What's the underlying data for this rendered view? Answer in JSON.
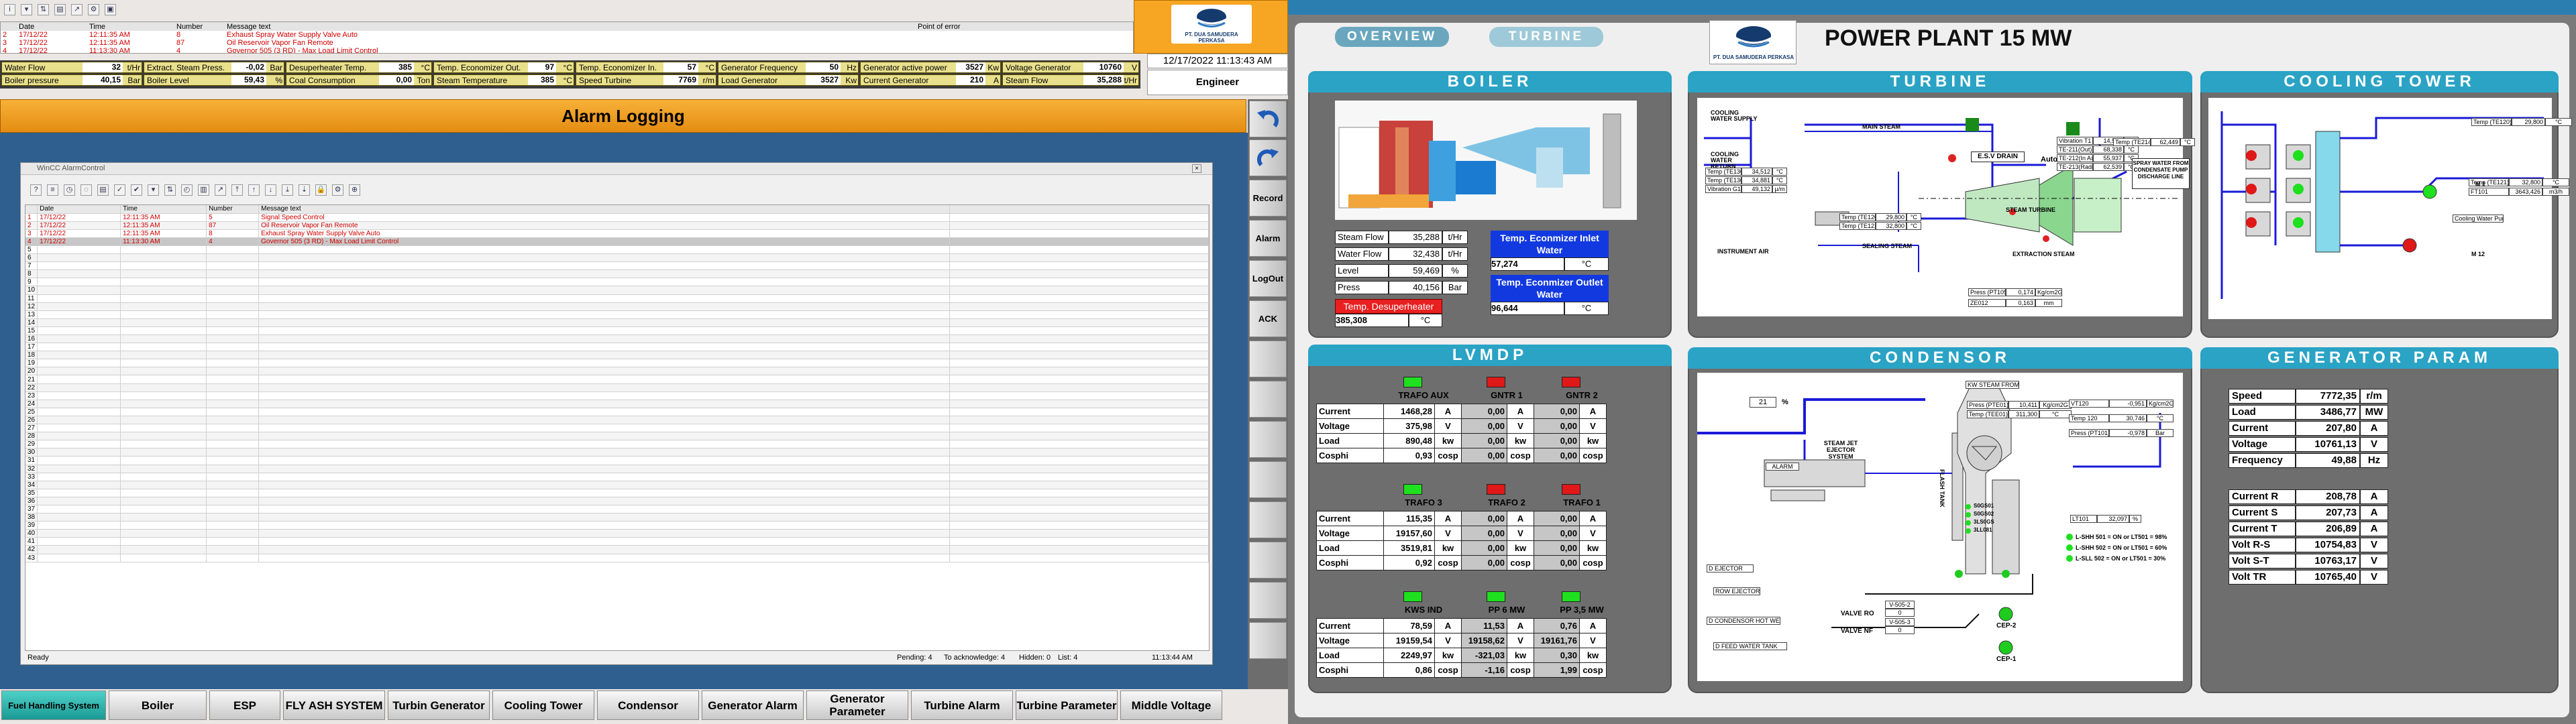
{
  "top_alarm": {
    "headers": [
      "Date",
      "Time",
      "Number",
      "Message text",
      "Point of error"
    ],
    "rows": [
      {
        "idx": "2",
        "date": "17/12/22",
        "time": "12:11:35 AM",
        "num": "8",
        "msg": "Exhaust Spray Water Supply Valve Auto"
      },
      {
        "idx": "3",
        "date": "17/12/22",
        "time": "12:11:35 AM",
        "num": "87",
        "msg": "Oil Reservoir Vapor Fan Remote"
      },
      {
        "idx": "4",
        "date": "17/12/22",
        "time": "11:13:30 AM",
        "num": "4",
        "msg": "Governor 505 (3 RD) - Max Load Limit Control"
      }
    ]
  },
  "toolbar_icons": [
    "info-icon",
    "filter-icon",
    "sort-icon",
    "print-icon",
    "export-icon",
    "settings-icon"
  ],
  "tags": [
    {
      "name": "Water Flow",
      "value": "32",
      "unit": "t/Hr"
    },
    {
      "name": "Boiler pressure",
      "value": "40,15",
      "unit": "Bar"
    },
    {
      "name": "Extract. Steam Press.",
      "value": "-0,02",
      "unit": "Bar"
    },
    {
      "name": "Boiler Level",
      "value": "59,43",
      "unit": "%"
    },
    {
      "name": "Desuperheater Temp.",
      "value": "385",
      "unit": "°C"
    },
    {
      "name": "Coal Consumption",
      "value": "0,00",
      "unit": "Ton"
    },
    {
      "name": "Temp. Economizer Out.",
      "value": "97",
      "unit": "°C"
    },
    {
      "name": "Steam Temperature",
      "value": "385",
      "unit": "°C"
    },
    {
      "name": "Temp. Economizer In.",
      "value": "57",
      "unit": "°C"
    },
    {
      "name": "Speed Turbine",
      "value": "7769",
      "unit": "r/m"
    },
    {
      "name": "Generator Frequency",
      "value": "50",
      "unit": "Hz"
    },
    {
      "name": "Load Generator",
      "value": "3527",
      "unit": "Kw"
    },
    {
      "name": "Generator active power",
      "value": "3527",
      "unit": "Kw"
    },
    {
      "name": "Current Generator",
      "value": "210",
      "unit": "A"
    },
    {
      "name": "Voltage Generator",
      "value": "10760",
      "unit": "V"
    },
    {
      "name": "Steam Flow",
      "value": "35,288",
      "unit": "t/Hr"
    }
  ],
  "company": "PT. DUA SAMUDERA PERKASA",
  "datetime": "12/17/2022 11:13:43 AM",
  "user": "Engineer",
  "page_title": "Alarm Logging",
  "alarm_window": {
    "title": "WinCC AlarmControl",
    "headers": [
      "Date",
      "Time",
      "Number",
      "Message text"
    ],
    "rows": [
      {
        "idx": "1",
        "date": "17/12/22",
        "time": "12:11:35 AM",
        "num": "5",
        "msg": "Signal Speed Control"
      },
      {
        "idx": "2",
        "date": "17/12/22",
        "time": "12:11:35 AM",
        "num": "87",
        "msg": "Oil Reservoir Vapor Fan Remote"
      },
      {
        "idx": "3",
        "date": "17/12/22",
        "time": "12:11:35 AM",
        "num": "8",
        "msg": "Exhaust Spray Water Supply Valve Auto"
      },
      {
        "idx": "4",
        "date": "17/12/22",
        "time": "11:13:30 AM",
        "num": "4",
        "msg": "Governor 505 (3 RD) - Max Load Limit Control"
      }
    ],
    "empty_rows": [
      "5",
      "6",
      "7",
      "8",
      "9",
      "10",
      "11",
      "12",
      "13",
      "14",
      "15",
      "16",
      "17",
      "18",
      "19",
      "20",
      "21",
      "22",
      "23",
      "24",
      "25",
      "26",
      "27",
      "28",
      "29",
      "30",
      "31",
      "32",
      "33",
      "34",
      "35",
      "36",
      "37",
      "38",
      "39",
      "40",
      "41",
      "42",
      "43"
    ],
    "status_ready": "Ready",
    "status_pending": "Pending: 4",
    "status_ack": "To acknowledge: 4",
    "status_hidden": "Hidden: 0",
    "status_list": "List: 4",
    "status_time": "11:13:44 AM"
  },
  "side_buttons": {
    "record": "Record",
    "alarm": "Alarm",
    "logout": "LogOut",
    "ack": "ACK"
  },
  "nav": [
    "Fuel Handling System",
    "Boiler",
    "ESP",
    "FLY ASH SYSTEM",
    "Turbin Generator",
    "Cooling Tower",
    "Condensor",
    "Generator Alarm",
    "Generator Parameter",
    "Turbine Alarm",
    "Turbine Parameter",
    "Middle Voltage"
  ],
  "plant": {
    "tabs": [
      "OVERVIEW",
      "TURBINE"
    ],
    "title": "POWER PLANT 15 MW",
    "logo_text": "PT. DUA SAMUDERA PERKASA",
    "boiler": {
      "title": "BOILER",
      "rows": [
        {
          "name": "Steam Flow",
          "value": "35,288",
          "unit": "t/Hr"
        },
        {
          "name": "Water Flow",
          "value": "32,438",
          "unit": "t/Hr"
        },
        {
          "name": "Level",
          "value": "59,469",
          "unit": "%"
        },
        {
          "name": "Press",
          "value": "40,156",
          "unit": "Bar"
        }
      ],
      "desup_label": "Temp. Desuperheater",
      "desup_value": "385,308",
      "desup_unit": "°C",
      "eco_in_label": "Temp. Econmizer Inlet Water",
      "eco_in_value": "57,274",
      "eco_in_unit": "°C",
      "eco_out_label": "Temp. Econmizer Outlet Water",
      "eco_out_value": "96,644",
      "eco_out_unit": "°C"
    },
    "turbine": {
      "title": "TURBINE",
      "labels": {
        "cooling_supply": "COOLING WATER SUPPLY",
        "cooling_return": "COOLING WATER RETURN",
        "main_steam": "MAIN STEAM",
        "esv": "E.S.V DRAIN",
        "auto": "Auto",
        "spray": "SPRAY WATER FROM CONDENSATE PUMP DISCHARGE LINE",
        "steam_turbine": "STEAM TURBINE",
        "sealing": "SEALING STEAM",
        "instr_air": "INSTRUMENT AIR",
        "extraction": "EXTRACTION STEAM"
      },
      "vib": [
        {
          "name": "Vibration T1",
          "value": "14,504",
          "unit": "µ/m"
        },
        {
          "name": "TE-211(Out)",
          "value": "68,338",
          "unit": "°C"
        },
        {
          "name": "TE-212(In Axle)",
          "value": "55,937",
          "unit": "°C"
        },
        {
          "name": "TE-213(Radial)",
          "value": "62,539",
          "unit": "°C"
        }
      ],
      "left": [
        {
          "name": "Temp (TE1306)",
          "value": "34,512",
          "unit": "°C"
        },
        {
          "name": "Temp (TE1308)",
          "value": "34,881",
          "unit": "°C"
        },
        {
          "name": "Vibration G1",
          "value": "49,132",
          "unit": "µ/m"
        }
      ],
      "mid": [
        {
          "name": "Temp (TE120)",
          "value": "29,800",
          "unit": "°C"
        },
        {
          "name": "Temp (TE121)",
          "value": "32,800",
          "unit": "°C"
        }
      ],
      "te214": {
        "name": "Temp (TE214)",
        "value": "62,449",
        "unit": "°C"
      },
      "press": {
        "name": "Press (PT105)",
        "value": "0,174",
        "unit": "Kg/cm2G"
      },
      "zs": {
        "name": "ZE012",
        "value": "0,163",
        "unit": "mm"
      }
    },
    "cooling": {
      "title": "COOLING TOWER",
      "te120": {
        "name": "Temp (TE120)",
        "value": "29,800",
        "unit": "°C"
      },
      "te121": {
        "name": "Temp (TE121)",
        "value": "32,800",
        "unit": "°C"
      },
      "ft101": {
        "name": "FT101",
        "value": "3643,426",
        "unit": "m3/h"
      },
      "pump_label": "Cooling Water Pump",
      "m1": "M 1",
      "m2": "M 12"
    },
    "lvmdp": {
      "title": "LVMDP",
      "groups": [
        {
          "heads": [
            "TRAFO AUX",
            "GNTR 1",
            "GNTR 2"
          ],
          "status": [
            "green",
            "red",
            "red"
          ],
          "rows": [
            {
              "name": "Current",
              "v": [
                "1468,28",
                "0,00",
                "0,00"
              ],
              "u": [
                "A",
                "A",
                "A"
              ]
            },
            {
              "name": "Voltage",
              "v": [
                "375,98",
                "0,00",
                "0,00"
              ],
              "u": [
                "V",
                "V",
                "V"
              ]
            },
            {
              "name": "Load",
              "v": [
                "890,48",
                "0,00",
                "0,00"
              ],
              "u": [
                "kw",
                "kw",
                "kw"
              ]
            },
            {
              "name": "Cosphi",
              "v": [
                "0,93",
                "0,00",
                "0,00"
              ],
              "u": [
                "cosp",
                "cosp",
                "cosp"
              ]
            }
          ]
        },
        {
          "heads": [
            "TRAFO 3",
            "TRAFO 2",
            "TRAFO 1"
          ],
          "status": [
            "green",
            "red",
            "red"
          ],
          "rows": [
            {
              "name": "Current",
              "v": [
                "115,35",
                "0,00",
                "0,00"
              ],
              "u": [
                "A",
                "A",
                "A"
              ]
            },
            {
              "name": "Voltage",
              "v": [
                "19157,60",
                "0,00",
                "0,00"
              ],
              "u": [
                "V",
                "V",
                "V"
              ]
            },
            {
              "name": "Load",
              "v": [
                "3519,81",
                "0,00",
                "0,00"
              ],
              "u": [
                "kw",
                "kw",
                "kw"
              ]
            },
            {
              "name": "Cosphi",
              "v": [
                "0,92",
                "0,00",
                "0,00"
              ],
              "u": [
                "cosp",
                "cosp",
                "cosp"
              ]
            }
          ]
        },
        {
          "heads": [
            "KWS IND",
            "PP 6 MW",
            "PP 3,5 MW"
          ],
          "status": [
            "green",
            "green",
            "green"
          ],
          "rows": [
            {
              "name": "Current",
              "v": [
                "78,59",
                "11,53",
                "0,76"
              ],
              "u": [
                "A",
                "A",
                "A"
              ]
            },
            {
              "name": "Voltage",
              "v": [
                "19159,54",
                "19158,62",
                "19161,76"
              ],
              "u": [
                "V",
                "V",
                "V"
              ]
            },
            {
              "name": "Load",
              "v": [
                "2249,97",
                "-321,03",
                "0,30"
              ],
              "u": [
                "kw",
                "kw",
                "kw"
              ]
            },
            {
              "name": "Cosphi",
              "v": [
                "0,86",
                "-1,16",
                "1,99"
              ],
              "u": [
                "cosp",
                "cosp",
                "cosp"
              ]
            }
          ]
        }
      ]
    },
    "condensor": {
      "title": "CONDENSOR",
      "kw_steam": "KW STEAM FROM",
      "pct": "21",
      "pct_unit": "%",
      "steam_jet": "STEAM JET EJECTOR SYSTEM",
      "press_pte01": {
        "name": "Press (PTE01)",
        "value": "10,411",
        "unit": "Kg/cm2G"
      },
      "temp_tee01": {
        "name": "Temp (TEE01)",
        "value": "311,300",
        "unit": "°C"
      },
      "vt120": {
        "name": "VT120",
        "value": "-0,951",
        "unit": "Kg/cm2G"
      },
      "temp120": {
        "name": "Temp 120",
        "value": "30,746",
        "unit": "°C"
      },
      "press_pt101": {
        "name": "Press (PT101)",
        "value": "-0,978",
        "unit": "Bar"
      },
      "flash_tank": "FLASH TANK",
      "ls": [
        "S0GS01",
        "S0GS02",
        "3LS0GS",
        "3LL081"
      ],
      "lt101": {
        "name": "LT101",
        "value": "32,097",
        "unit": "%"
      },
      "levels": [
        "L-SHH 501 = ON or LT501 = 98%",
        "L-SHH 502 = ON or LT501 = 60%",
        "L-SLL 502 = ON or LT501 = 30%"
      ],
      "legend": [
        "D EJECTOR",
        "ROW EJECTOR",
        "D CONDENSOR HOT WELL",
        "D FEED WATER TANK"
      ],
      "valves": [
        {
          "name": "VALVE RO",
          "v1": "V-505-2",
          "v2": "0"
        },
        {
          "name": "VALVE NF",
          "v1": "V-505-3",
          "v2": "0"
        }
      ],
      "pumps": [
        "CEP-2",
        "CEP-1"
      ],
      "alarm": "ALARM"
    },
    "gen": {
      "title": "GENERATOR PARAM",
      "a": [
        {
          "name": "Speed",
          "value": "7772,35",
          "unit": "r/m"
        },
        {
          "name": "Load",
          "value": "3486,77",
          "unit": "MW"
        },
        {
          "name": "Current",
          "value": "207,80",
          "unit": "A"
        },
        {
          "name": "Voltage",
          "value": "10761,13",
          "unit": "V"
        },
        {
          "name": "Frequency",
          "value": "49,88",
          "unit": "Hz"
        }
      ],
      "b": [
        {
          "name": "Current R",
          "value": "208,78",
          "unit": "A"
        },
        {
          "name": "Current S",
          "value": "207,73",
          "unit": "A"
        },
        {
          "name": "Current T",
          "value": "206,89",
          "unit": "A"
        },
        {
          "name": "Volt R-S",
          "value": "10754,83",
          "unit": "V"
        },
        {
          "name": "Volt S-T",
          "value": "10763,17",
          "unit": "V"
        },
        {
          "name": "Volt TR",
          "value": "10765,40",
          "unit": "V"
        }
      ]
    }
  }
}
